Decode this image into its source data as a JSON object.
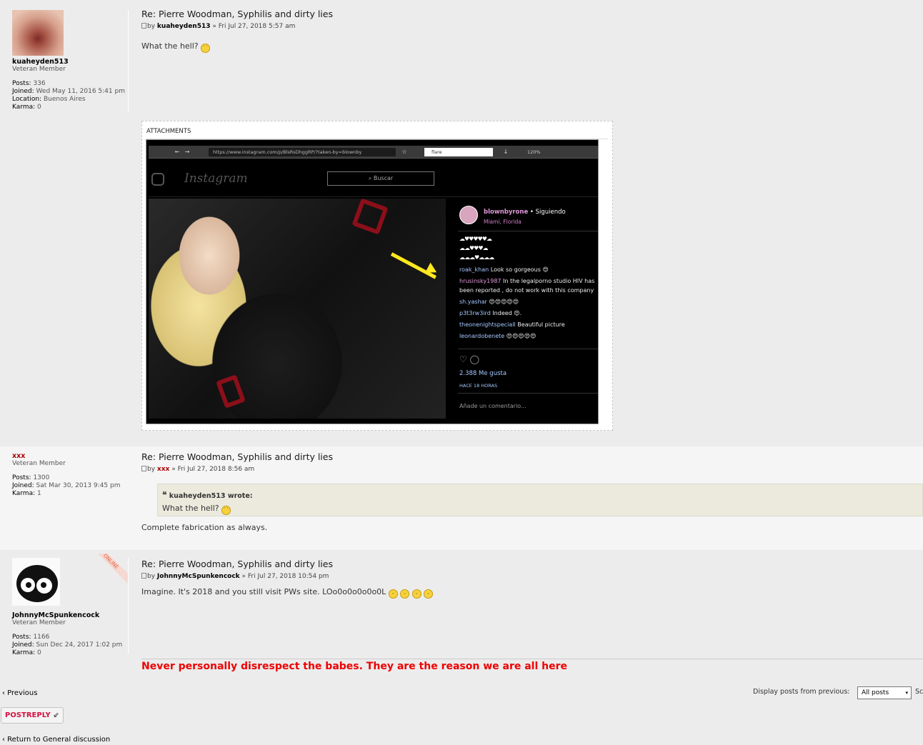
{
  "posts": [
    {
      "title": "Re: Pierre Woodman, Syphilis and dirty lies",
      "by_label": "by",
      "author": "kuaheyden513",
      "date": "» Fri Jul 27, 2018 5:57 am",
      "content": "What the hell?",
      "rank": "Veteran Member",
      "posts_label": "Posts:",
      "posts": "336",
      "joined_label": "Joined:",
      "joined": "Wed May 11, 2016 5:41 pm",
      "location_label": "Location:",
      "location": "Buenos Aires",
      "karma_label": "Karma:",
      "karma": "0"
    },
    {
      "title": "Re: Pierre Woodman, Syphilis and dirty lies",
      "by_label": "by",
      "author": "xxx",
      "date": "» Fri Jul 27, 2018 8:56 am",
      "quote_author": "kuaheyden513 wrote:",
      "quote_text": "What the hell?",
      "content": "Complete fabrication as always.",
      "rank": "Veteran Member",
      "posts_label": "Posts:",
      "posts": "1300",
      "joined_label": "Joined:",
      "joined": "Sat Mar 30, 2013 9:45 pm",
      "karma_label": "Karma:",
      "karma": "1"
    },
    {
      "title": "Re: Pierre Woodman, Syphilis and dirty lies",
      "by_label": "by",
      "author": "JohnnyMcSpunkencock",
      "date": "» Fri Jul 27, 2018 10:54 pm",
      "content": "Imagine. It's 2018 and you still visit PWs site. LOo0o0o0o0o0L",
      "rank": "Veteran Member",
      "online": "ONLINE",
      "posts_label": "Posts:",
      "posts": "1166",
      "joined_label": "Joined:",
      "joined": "Sun Dec 24, 2017 1:02 pm",
      "karma_label": "Karma:",
      "karma": "0",
      "signature": "Never personally disrespect the babes. They are the reason we are all here"
    }
  ],
  "attachment": {
    "label": "ATTACHMENTS",
    "browser_url": "https://www.instagram.com/p/BlsRsDhggRP/?taken-by=blownby",
    "browser_search": "flare",
    "browser_zoom": "120%",
    "ig_logo": "Instagram",
    "ig_search": "Buscar",
    "ig_user": "blownbyrone",
    "ig_following": "• Siguiendo",
    "ig_location": "Miami, Florida",
    "ig_caption_1": "☁♥♥♥♥♥☁",
    "ig_caption_2": "☁☁♥♥♥☁",
    "ig_caption_3": "☁☁☁♥☁☁☁",
    "comments": [
      {
        "user": "roak_khan",
        "text": " Look so gorgeous 😍"
      },
      {
        "user": "hrusinsky1987",
        "text": " In the legalporno studio HIV has been reported , do not work with this company"
      },
      {
        "user": "sh.yashar",
        "text": " 😍😍😍😍😍"
      },
      {
        "user": "p3t3rw3ird",
        "text": " Indeed 😍."
      },
      {
        "user": "theonenightspeciall",
        "text": " Beautiful picture"
      },
      {
        "user": "leonardobenete",
        "text": " 😍😍😍😍😍"
      }
    ],
    "likes": "2.388 Me gusta",
    "time": "HACE 18 HORAS",
    "add_comment": "Añade un comentario..."
  },
  "nav": {
    "previous": "‹ Previous",
    "display_label": "Display posts from previous:",
    "display_value": "All posts",
    "sort_label": "Sc",
    "post_reply": "POSTREPLY",
    "return": "‹ Return to General discussion"
  },
  "colors": {
    "signature": "#ee0000",
    "reply_button_text": "#d31141",
    "quote_bg": "#ebeadd"
  }
}
